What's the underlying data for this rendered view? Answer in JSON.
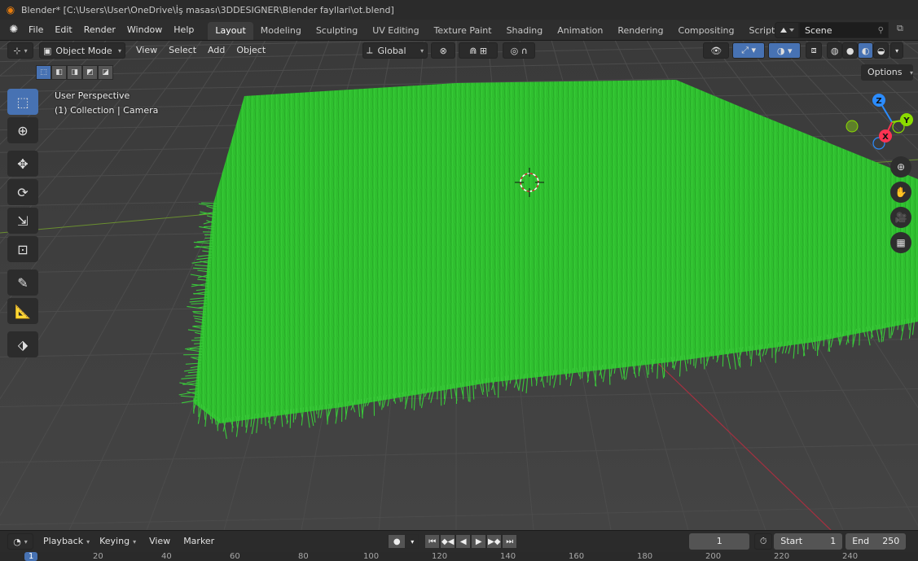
{
  "window": {
    "title": "Blender* [C:\\Users\\User\\OneDrive\\İş masası\\3DDESIGNER\\Blender fayllari\\ot.blend]"
  },
  "menu": [
    "File",
    "Edit",
    "Render",
    "Window",
    "Help"
  ],
  "workspaces": [
    "Layout",
    "Modeling",
    "Sculpting",
    "UV Editing",
    "Texture Paint",
    "Shading",
    "Animation",
    "Rendering",
    "Compositing",
    "Scripting"
  ],
  "active_workspace": "Layout",
  "scene": {
    "name": "Scene"
  },
  "viewport_header": {
    "mode": "Object Mode",
    "menus": [
      "View",
      "Select",
      "Add",
      "Object"
    ],
    "transform_orientation": "Global",
    "options_label": "Options"
  },
  "overlay": {
    "view_name": "User Perspective",
    "collection_info": "(1) Collection | Camera"
  },
  "gizmo": {
    "z": "Z",
    "y": "Y",
    "x": "X"
  },
  "timeline": {
    "playback": "Playback",
    "keying": "Keying",
    "view": "View",
    "marker": "Marker",
    "current_frame": "1",
    "start_label": "Start",
    "start_value": "1",
    "end_label": "End",
    "end_value": "250"
  },
  "ruler": {
    "current": "1",
    "ticks": [
      "20",
      "40",
      "60",
      "80",
      "100",
      "120",
      "140",
      "160",
      "180",
      "200",
      "220",
      "240"
    ]
  },
  "colors": {
    "accent": "#4772b3",
    "grass": "#2fbf2f",
    "x_axis": "#ff3352",
    "y_axis": "#8bdc00",
    "z_axis": "#2b8cff"
  }
}
